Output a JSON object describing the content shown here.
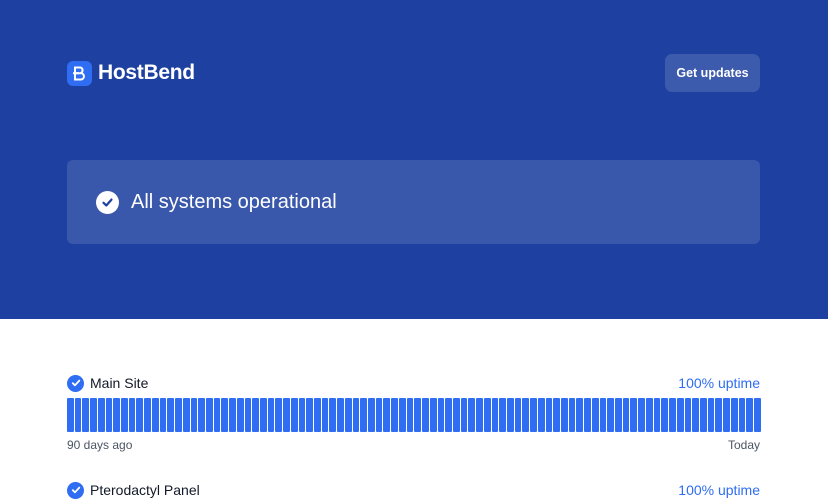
{
  "brand": {
    "name": "HostBend",
    "accent": "#2f6df2",
    "hero_bg": "#1e40a0"
  },
  "header": {
    "updates_label": "Get updates"
  },
  "status": {
    "message": "All systems operational",
    "icon": "check-circle-icon"
  },
  "components": [
    {
      "name": "Main Site",
      "uptime": "100% uptime",
      "days": 90,
      "range_start": "90 days ago",
      "range_end": "Today"
    },
    {
      "name": "Pterodactyl Panel",
      "uptime": "100% uptime"
    }
  ]
}
